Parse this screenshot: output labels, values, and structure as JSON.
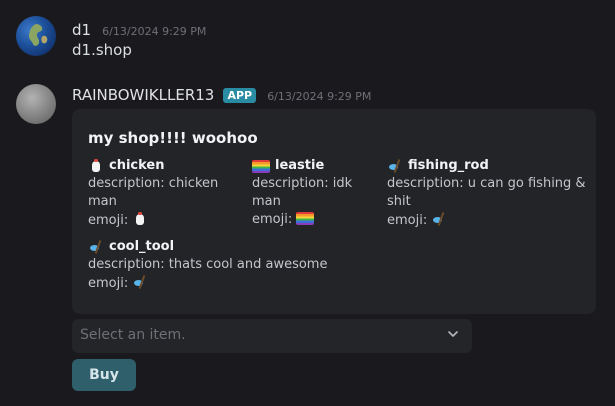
{
  "messages": [
    {
      "author": "d1",
      "timestamp": "6/13/2024 9:29 PM",
      "content": "d1.shop"
    },
    {
      "author": "RAINBOWIKLLER13",
      "badge": "APP",
      "timestamp": "6/13/2024 9:29 PM",
      "embed": {
        "title": "my shop!!!! woohoo",
        "fields": [
          {
            "name": "chicken",
            "icon": "chicken-emoji",
            "description": "description: chicken man",
            "emoji_label": "emoji:"
          },
          {
            "name": "leastie",
            "icon": "pride-flag-emoji",
            "description": "description: idk man",
            "emoji_label": "emoji:"
          },
          {
            "name": "fishing_rod",
            "icon": "fishing-pole-emoji",
            "description": "description: u can go fishing & shit",
            "emoji_label": "emoji:"
          },
          {
            "name": "cool_tool",
            "icon": "fishing-pole-emoji",
            "description": "description: thats cool and awesome",
            "emoji_label": "emoji:"
          }
        ]
      },
      "select": {
        "placeholder": "Select an item."
      },
      "button": {
        "label": "Buy"
      }
    }
  ],
  "colors": {
    "background": "#1a1a1e",
    "embed": "#232428",
    "app_badge": "#2a8ca3",
    "buy_button": "#2e5f6a"
  }
}
